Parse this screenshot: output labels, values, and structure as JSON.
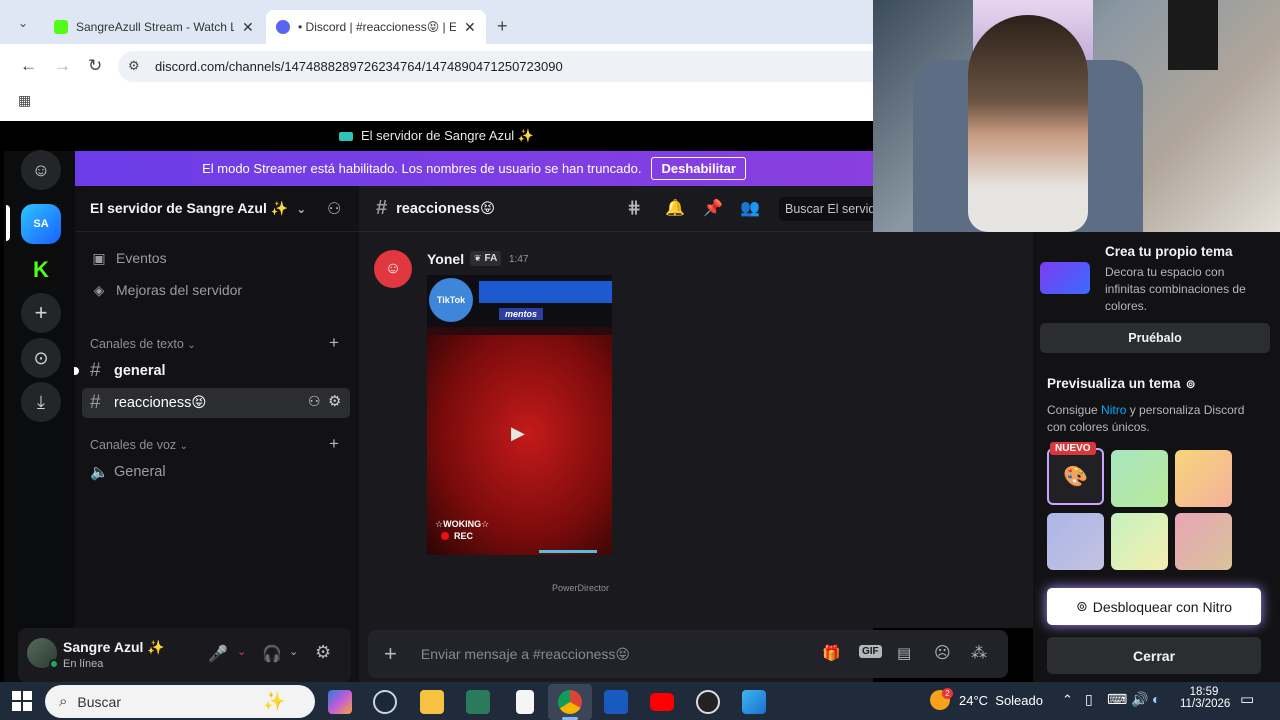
{
  "browser": {
    "tabs": [
      {
        "title": "SangreAzull Stream - Watch Liv",
        "close": "✕"
      },
      {
        "title": "• Discord | #reaccioness😝 | El s",
        "close": "✕"
      }
    ],
    "new_tab": "+",
    "url": "discord.com/channels/1474888289726234764/1474890471250723090"
  },
  "discord": {
    "window_title": "El servidor de Sangre Azul ✨",
    "streamer_banner": {
      "text": "El modo Streamer está habilitado. Los nombres de usuario se han truncado.",
      "button": "Deshabilitar"
    },
    "server_name": "El servidor de Sangre Azul ✨",
    "sidebar": {
      "events": "Eventos",
      "boosts": "Mejoras del servidor",
      "text_category": "Canales de texto",
      "text_channels": [
        "general",
        "reaccioness😝"
      ],
      "voice_category": "Canales de voz",
      "voice_channels": [
        "General"
      ]
    },
    "user": {
      "name": "Sangre Azul ✨",
      "status": "En línea"
    },
    "channel": {
      "name": "reaccioness😝",
      "search_placeholder": "Buscar El servid"
    },
    "message": {
      "author": "Yonel",
      "tag": "FA",
      "time": "1:47",
      "video_overlay_top": "TikTok",
      "video_label": "mentos",
      "video_caption": "☆WOKING☆",
      "video_rec": "REC",
      "watermark": "PowerDirector"
    },
    "composer_placeholder": "Enviar mensaje a #reaccioness😝"
  },
  "right_panel": {
    "theme_title": "Crea tu propio tema",
    "theme_desc": "Decora tu espacio con infinitas combinaciones de colores.",
    "try_button": "Pruébalo",
    "preview_title": "Previsualiza un tema",
    "preview_desc_1": "Consigue ",
    "preview_nitro": "Nitro",
    "preview_desc_2": " y personaliza Discord con colores únicos.",
    "new_badge": "NUEVO",
    "unlock_button": "Desbloquear con Nitro",
    "close_button": "Cerrar"
  },
  "taskbar": {
    "search": "Buscar",
    "weather": "24°C  Soleado",
    "time": "18:59",
    "date": "11/3/2026",
    "weather_badge": "2"
  },
  "colors": {
    "accent": "#5865f2",
    "banner": "#6b3de8",
    "nitro": "#00a8fc"
  }
}
